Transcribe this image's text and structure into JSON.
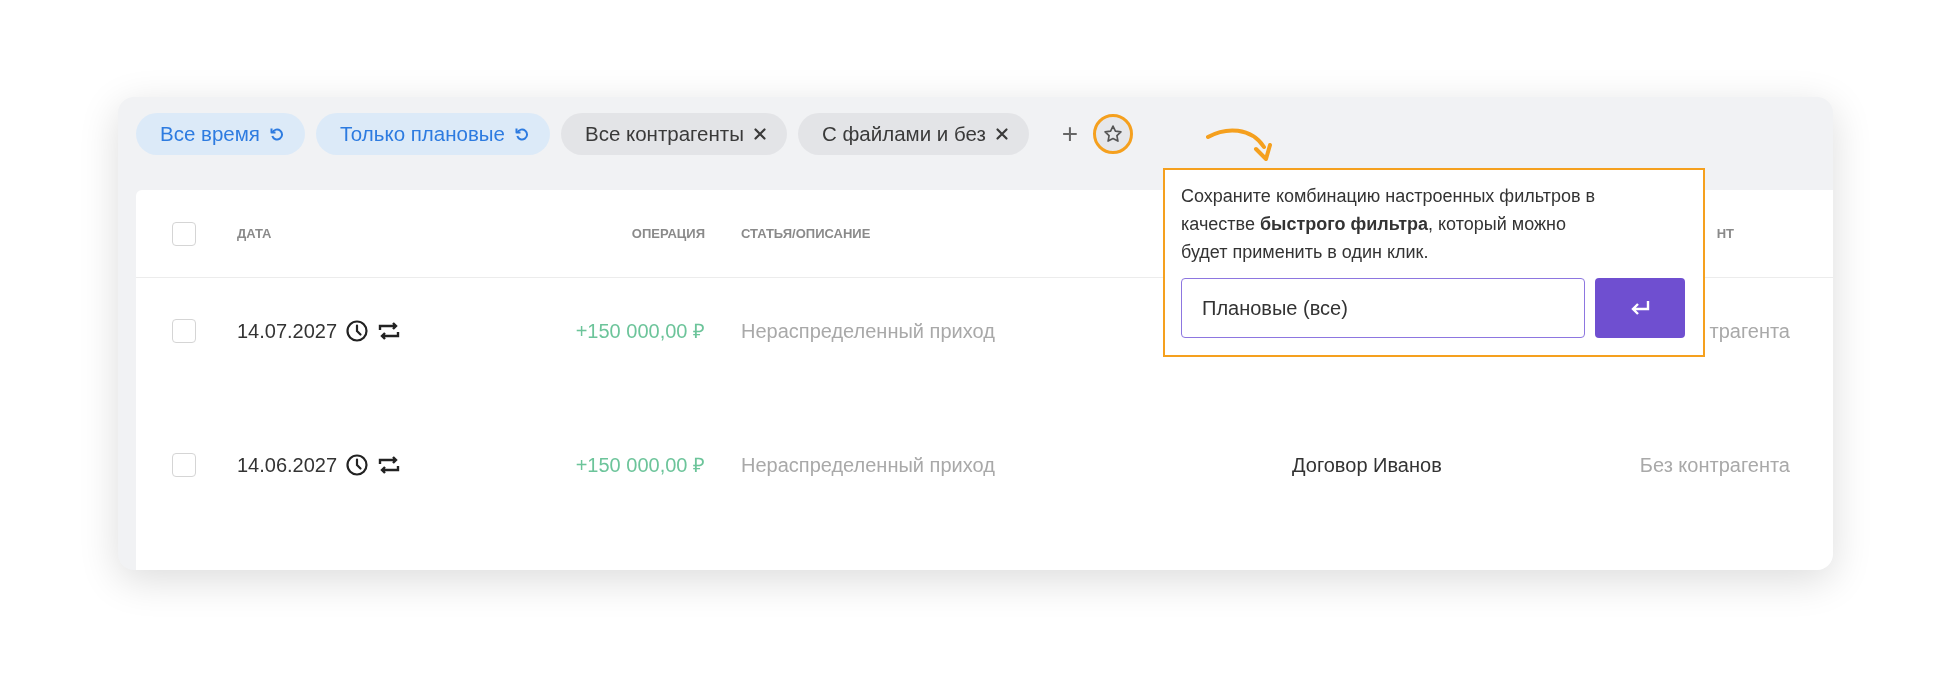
{
  "filters": [
    {
      "label": "Все время",
      "kind": "preset"
    },
    {
      "label": "Только плановые",
      "kind": "preset"
    },
    {
      "label": "Все контрагенты",
      "kind": "removable"
    },
    {
      "label": "С файлами и без",
      "kind": "removable"
    }
  ],
  "add_button": "+",
  "table": {
    "header": {
      "checked": false,
      "date": "ДАТА",
      "operation": "ОПЕРАЦИЯ",
      "description": "СТАТЬЯ/ОПИСАНИЕ",
      "column_5": "НТ"
    },
    "rows": [
      {
        "checked": false,
        "date": "14.07.2027",
        "operation": "+150 000,00 ₽",
        "description": "Нераспределенный приход",
        "column_5": "трагента"
      },
      {
        "checked": false,
        "date": "14.06.2027",
        "operation": "+150 000,00 ₽",
        "description": "Нераспределенный приход",
        "column_4": "Договор Иванов",
        "column_5": "Без контрагента"
      }
    ]
  },
  "popover": {
    "text": "Сохраните комбинацию настроенных фильтров в качестве **быстрого фильтра**, который можно будет применить в один клик.",
    "input_value": "Плановые (все)"
  }
}
